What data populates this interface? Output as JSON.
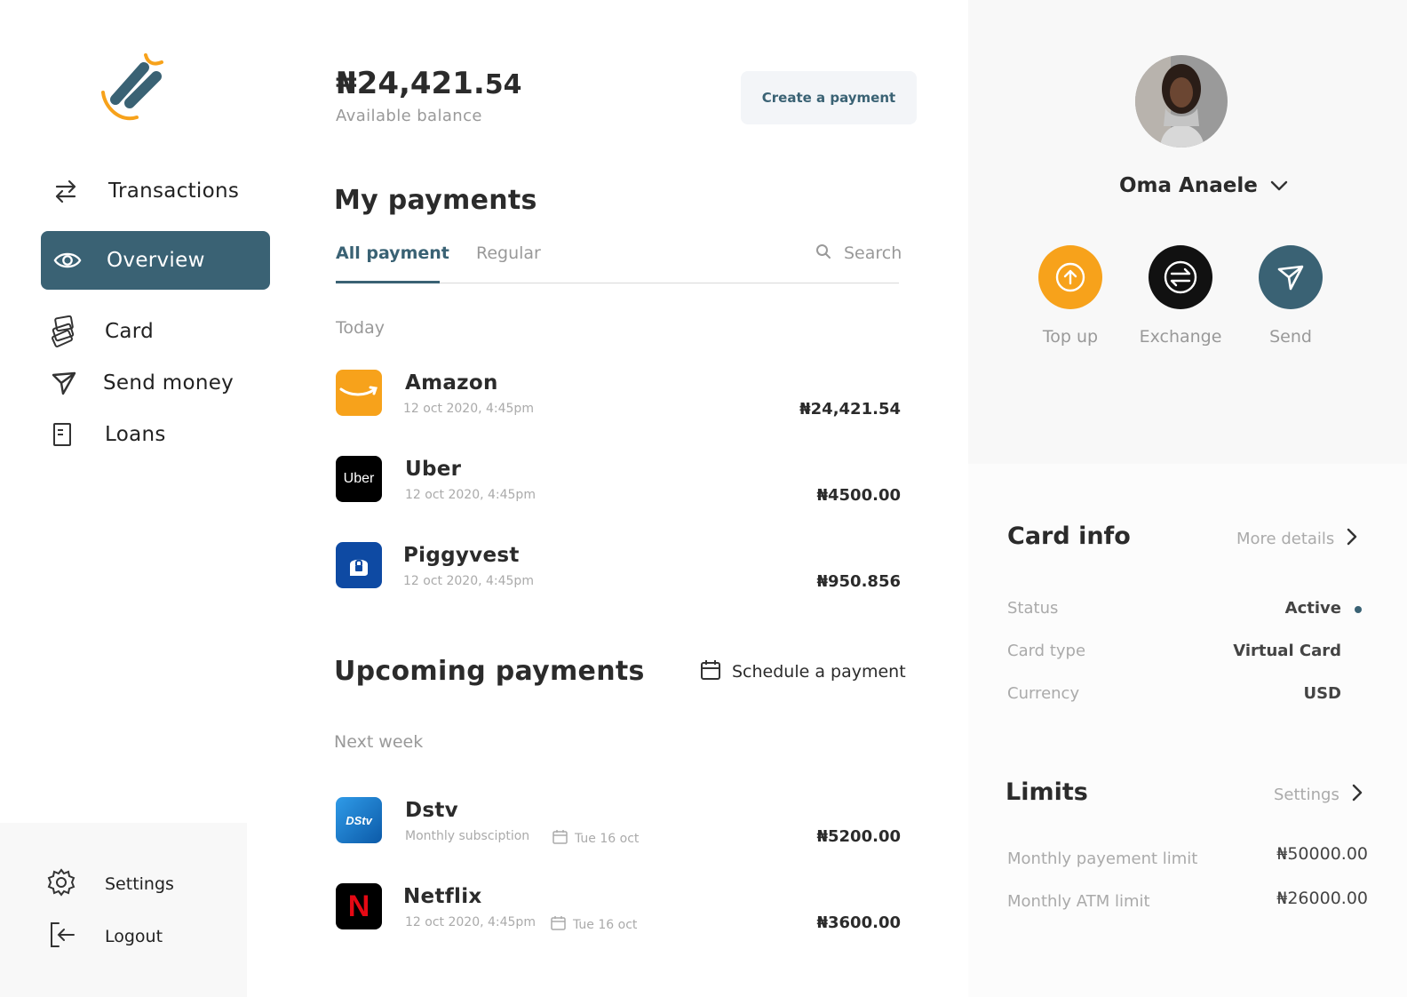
{
  "brand": {
    "accent": "#3a6274",
    "orange": "#f7a21b"
  },
  "sidebar": {
    "items": [
      {
        "label": "Transactions",
        "icon": "transfer-arrows-icon",
        "active": false
      },
      {
        "label": "Overview",
        "icon": "eye-icon",
        "active": true
      },
      {
        "label": "Card",
        "icon": "card-stack-icon",
        "active": false
      },
      {
        "label": "Send money",
        "icon": "paper-plane-icon",
        "active": false
      },
      {
        "label": "Loans",
        "icon": "document-icon",
        "active": false
      }
    ],
    "bottom": [
      {
        "label": "Settings",
        "icon": "gear-icon"
      },
      {
        "label": "Logout",
        "icon": "logout-icon"
      }
    ]
  },
  "balance": {
    "currency": "₦",
    "whole": "24,421.",
    "cents": "54",
    "label": "Available balance"
  },
  "create_payment_label": "Create a payment",
  "my_payments": {
    "title": "My payments",
    "tabs": [
      {
        "label": "All payment",
        "active": true
      },
      {
        "label": "Regular",
        "active": false
      }
    ],
    "search_label": "Search",
    "group_label": "Today",
    "items": [
      {
        "name": "Amazon",
        "date": "12 oct 2020, 4:45pm",
        "amount": "₦24,421.54",
        "logo": "amazon-logo",
        "logo_bg": "#f7a21b"
      },
      {
        "name": "Uber",
        "date": "12 oct 2020, 4:45pm",
        "amount": "₦4500.00",
        "logo": "uber-logo",
        "logo_bg": "#000000",
        "logo_text": "Uber"
      },
      {
        "name": "Piggyvest",
        "date": "12 oct 2020, 4:45pm",
        "amount": "₦950.856",
        "logo": "piggyvest-logo",
        "logo_bg": "#0e4aa3"
      }
    ]
  },
  "upcoming": {
    "title": "Upcoming payments",
    "schedule_label": "Schedule a payment",
    "group_label": "Next week",
    "items": [
      {
        "name": "Dstv",
        "date": "Monthly subsciption",
        "due": "Tue 16 oct",
        "amount": "₦5200.00",
        "logo": "dstv-logo",
        "logo_bg": "#1b7fd0",
        "logo_text": "DStv"
      },
      {
        "name": "Netflix",
        "date": "12 oct 2020, 4:45pm",
        "due": "Tue 16 oct",
        "amount": "₦3600.00",
        "logo": "netflix-logo",
        "logo_bg": "#000000",
        "logo_text": "N"
      }
    ]
  },
  "profile": {
    "name": "Oma Anaele",
    "actions": [
      {
        "label": "Top up",
        "icon": "arrow-up-circle-icon",
        "color": "#f7a21b"
      },
      {
        "label": "Exchange",
        "icon": "exchange-icon",
        "color": "#111111"
      },
      {
        "label": "Send",
        "icon": "paper-plane-icon",
        "color": "#3a6274"
      }
    ]
  },
  "card_info": {
    "title": "Card info",
    "link_label": "More details",
    "rows": [
      {
        "label": "Status",
        "value": "Active"
      },
      {
        "label": "Card type",
        "value": "Virtual Card"
      },
      {
        "label": "Currency",
        "value": "USD"
      }
    ]
  },
  "limits": {
    "title": "Limits",
    "link_label": "Settings",
    "rows": [
      {
        "label": "Monthly payement limit",
        "value": "₦50000.00"
      },
      {
        "label": "Monthly ATM limit",
        "value": "₦26000.00"
      }
    ]
  }
}
